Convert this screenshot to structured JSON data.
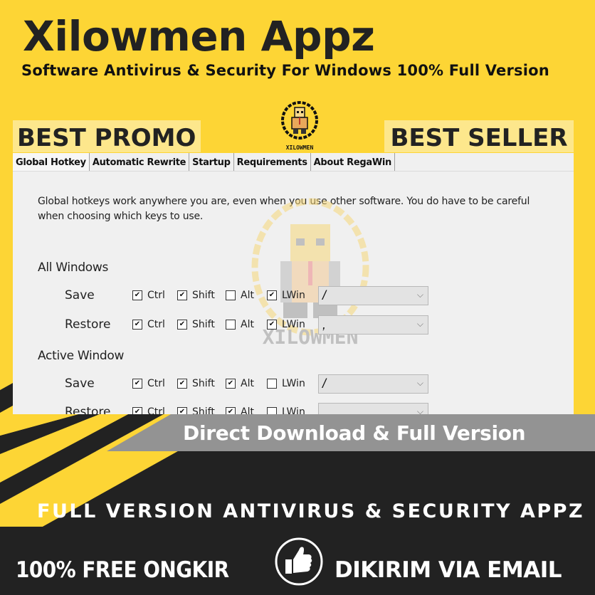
{
  "header": {
    "title": "Xilowmen Appz",
    "subtitle": "Software Antivirus & Security For Windows 100% Full Version"
  },
  "badges": {
    "left": "BEST PROMO",
    "right": "BEST SELLER"
  },
  "logo": {
    "icon": "pixel-man-logo-icon",
    "text": "XILOWMEN"
  },
  "window": {
    "tabs": [
      {
        "label": "Global Hotkey",
        "active": true
      },
      {
        "label": "Automatic Rewrite",
        "active": false
      },
      {
        "label": "Startup",
        "active": false
      },
      {
        "label": "Requirements",
        "active": false
      },
      {
        "label": "About RegaWin",
        "active": false
      }
    ],
    "description_line1": "Global hotkeys work anywhere you are, even when you use other software. You do have to be careful",
    "description_line2": "when choosing which keys to use.",
    "sections": [
      {
        "title": "All Windows",
        "rows": [
          {
            "label": "Save",
            "ctrl": true,
            "shift": true,
            "alt": false,
            "lwin": true,
            "key": "/"
          },
          {
            "label": "Restore",
            "ctrl": true,
            "shift": true,
            "alt": false,
            "lwin": true,
            "key": ","
          }
        ]
      },
      {
        "title": "Active Window",
        "rows": [
          {
            "label": "Save",
            "ctrl": true,
            "shift": true,
            "alt": true,
            "lwin": false,
            "key": "/"
          },
          {
            "label": "Restore",
            "ctrl": true,
            "shift": true,
            "alt": true,
            "lwin": false,
            "key": ""
          }
        ]
      }
    ],
    "modifier_labels": {
      "ctrl": "Ctrl",
      "shift": "Shift",
      "alt": "Alt",
      "lwin": "LWin"
    },
    "watermark_text": "XILOWMEN"
  },
  "banner": {
    "download": "Direct Download & Full Version",
    "full_version": "FULL VERSION ANTIVIRUS & SECURITY APPZ",
    "free_ongkir": "100% FREE ONGKIR",
    "dikirim": "DIKIRIM VIA EMAIL",
    "thumb_icon": "thumbs-up-icon"
  },
  "colors": {
    "brand_yellow": "#fdd535",
    "badge_yellow": "#fde78c",
    "dark": "#222222",
    "gray_banner": "#939393",
    "window_bg": "#f0f0f0"
  }
}
